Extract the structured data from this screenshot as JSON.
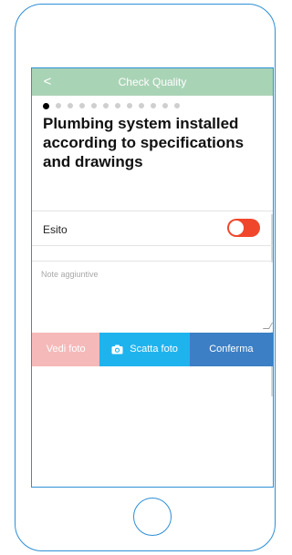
{
  "colors": {
    "frame": "#2d8fd6",
    "nav_bar": "#a9d3b5",
    "toggle": "#f0472c",
    "vedi_foto": "#f5b9b9",
    "scatta_foto": "#1fb3ee",
    "conferma": "#3c7fc5"
  },
  "nav": {
    "back_icon": "chevron-left-icon",
    "back_glyph": "<",
    "title": "Check Quality"
  },
  "pager": {
    "total": 12,
    "current": 1
  },
  "question": {
    "title": "Plumbing system installed according to specifications and drawings"
  },
  "esito": {
    "label": "Esito",
    "toggle_on": true
  },
  "notes": {
    "placeholder": "Note aggiuntive",
    "value": ""
  },
  "actions": {
    "vedi_foto": "Vedi foto",
    "scatta_foto": "Scatta foto",
    "scatta_icon": "camera-icon",
    "conferma": "Conferma"
  }
}
